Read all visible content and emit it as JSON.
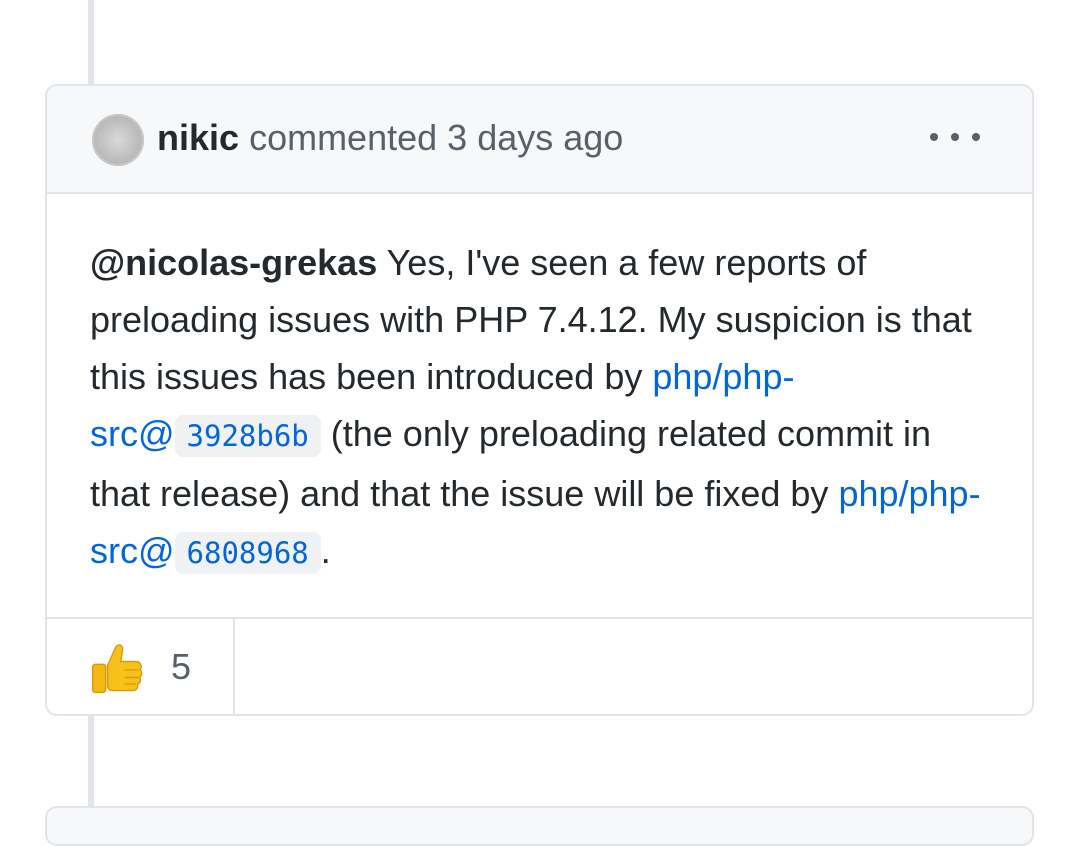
{
  "comment": {
    "author": "nikic",
    "action": "commented",
    "time": "3 days ago",
    "body": {
      "mention": "@nicolas-grekas",
      "text1": " Yes, I've seen a few reports of preloading issues with PHP 7.4.12. My suspicion is that this issues has been introduced by ",
      "ref1_repo": "php/php-src@",
      "ref1_sha": "3928b6b",
      "text2": " (the only preloading related commit in that release) and that the issue will be fixed by ",
      "ref2_repo": "php/php-src@",
      "ref2_sha": "6808968",
      "text3": "."
    },
    "reactions": [
      {
        "emoji": "thumbs-up",
        "count": "5"
      }
    ]
  },
  "colors": {
    "link": "#0366d6",
    "header_bg": "#f6f8fa",
    "border": "#e1e4e8",
    "muted_text": "#586069"
  }
}
